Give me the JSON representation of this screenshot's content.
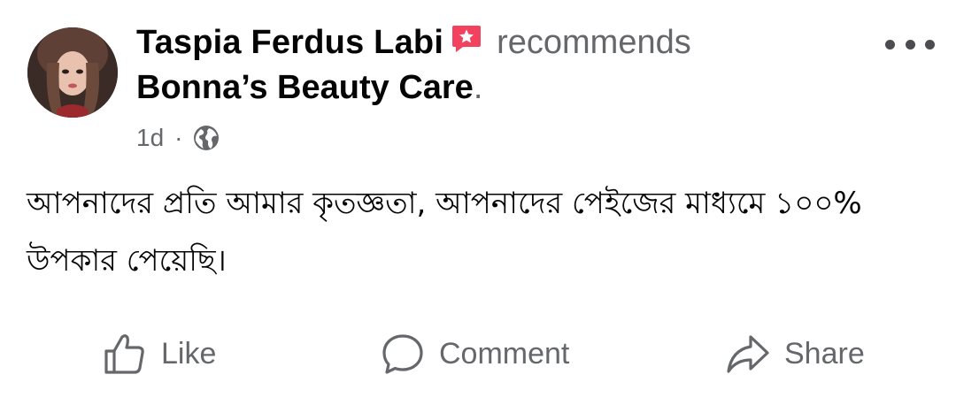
{
  "post": {
    "author_name": "Taspia Ferdus Labi",
    "action_text": "recommends",
    "page_name": "Bonna’s Beauty Care",
    "page_name_suffix": ".",
    "timestamp": "1d",
    "meta_separator": "·",
    "audience_icon": "globe-icon",
    "badge_icon": "recommendation-badge-icon",
    "more_icon": "more-options-icon",
    "body_text": "আপনাদের প্রতি আমার কৃতজ্ঞতা, আপনাদের পেইজের মাধ্যমে ১০০% উপকার পেয়েছি।"
  },
  "actions": {
    "like_label": "Like",
    "comment_label": "Comment",
    "share_label": "Share"
  },
  "colors": {
    "primary_text": "#050505",
    "secondary_text": "#65676b",
    "badge": "#f3425f"
  }
}
